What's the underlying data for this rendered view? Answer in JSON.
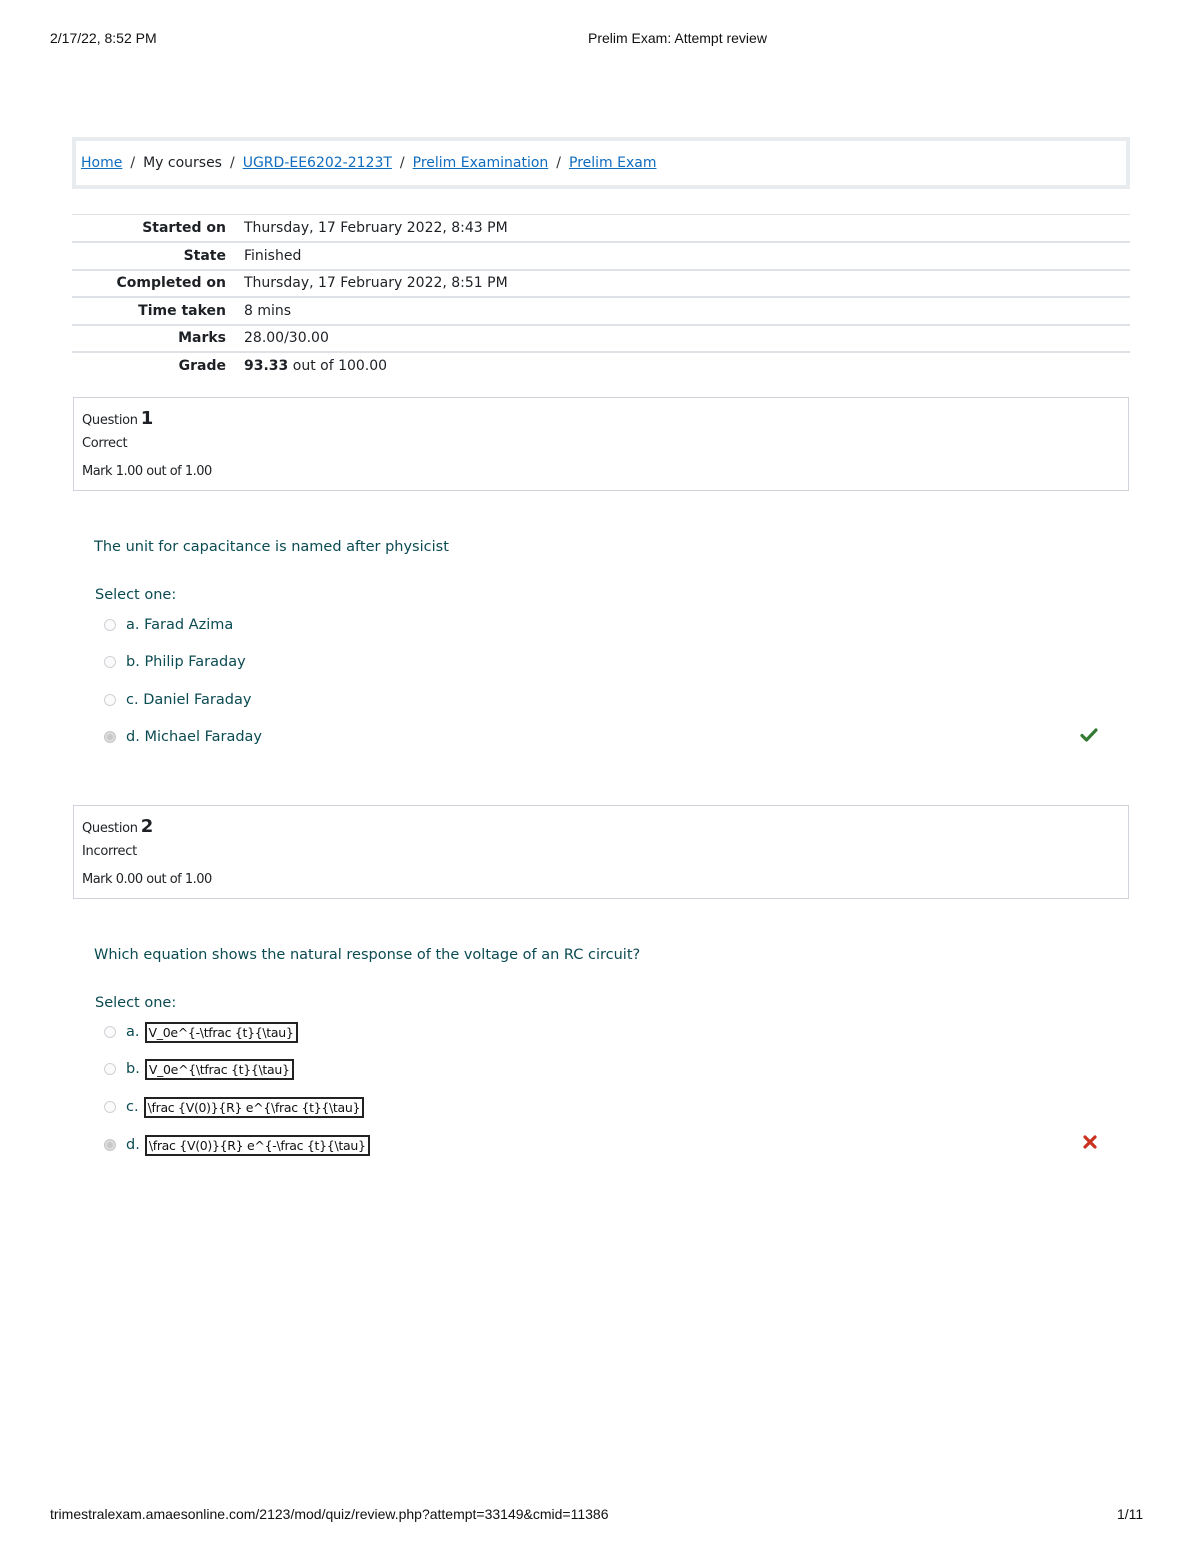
{
  "print_header": {
    "datetime": "2/17/22, 8:52 PM",
    "title": "Prelim Exam: Attempt review"
  },
  "print_footer": {
    "url": "trimestralexam.amaesonline.com/2123/mod/quiz/review.php?attempt=33149&cmid=11386",
    "page": "1/11"
  },
  "breadcrumb": {
    "items": [
      {
        "label": "Home",
        "link": true
      },
      {
        "label": "My courses",
        "link": false
      },
      {
        "label": "UGRD-EE6202-2123T",
        "link": true
      },
      {
        "label": "Prelim Examination",
        "link": true
      },
      {
        "label": "Prelim Exam",
        "link": true
      }
    ],
    "separator": "/"
  },
  "summary": {
    "rows": [
      {
        "label": "Started on",
        "value": "Thursday, 17 February 2022, 8:43 PM"
      },
      {
        "label": "State",
        "value": "Finished"
      },
      {
        "label": "Completed on",
        "value": "Thursday, 17 February 2022, 8:51 PM"
      },
      {
        "label": "Time taken",
        "value": "8 mins"
      },
      {
        "label": "Marks",
        "value": "28.00/30.00"
      }
    ],
    "grade": {
      "label": "Grade",
      "value": "93.33",
      "suffix": "out of 100.00"
    }
  },
  "questions": [
    {
      "label": "Question",
      "number": "1",
      "state": "Correct",
      "mark": "Mark 1.00 out of 1.00",
      "text": "The unit for capacitance is named after physicist",
      "prompt": "Select one:",
      "answers": [
        {
          "letter": "a.",
          "text": "Farad Azima",
          "selected": false
        },
        {
          "letter": "b.",
          "text": "Philip Faraday",
          "selected": false
        },
        {
          "letter": "c.",
          "text": "Daniel Faraday",
          "selected": false
        },
        {
          "letter": "d.",
          "text": "Michael Faraday",
          "selected": true
        }
      ],
      "feedback_icon": "check-icon",
      "feedback_color": "#357a32"
    },
    {
      "label": "Question",
      "number": "2",
      "state": "Incorrect",
      "mark": "Mark 0.00 out of 1.00",
      "text": "Which equation shows the natural response of the voltage of an RC circuit?",
      "prompt": "Select one:",
      "answers": [
        {
          "letter": "a.",
          "text": "V_0e^{-\\tfrac {t}{\\tau}",
          "selected": false
        },
        {
          "letter": "b.",
          "text": "V_0e^{\\tfrac {t}{\\tau}",
          "selected": false
        },
        {
          "letter": "c.",
          "text": "\\frac {V(0)}{R} e^{\\frac {t}{\\tau}",
          "selected": false
        },
        {
          "letter": "d.",
          "text": "\\frac {V(0)}{R} e^{-\\frac {t}{\\tau}",
          "selected": true
        }
      ],
      "feedback_icon": "cross-icon",
      "feedback_color": "#ca3120"
    }
  ]
}
